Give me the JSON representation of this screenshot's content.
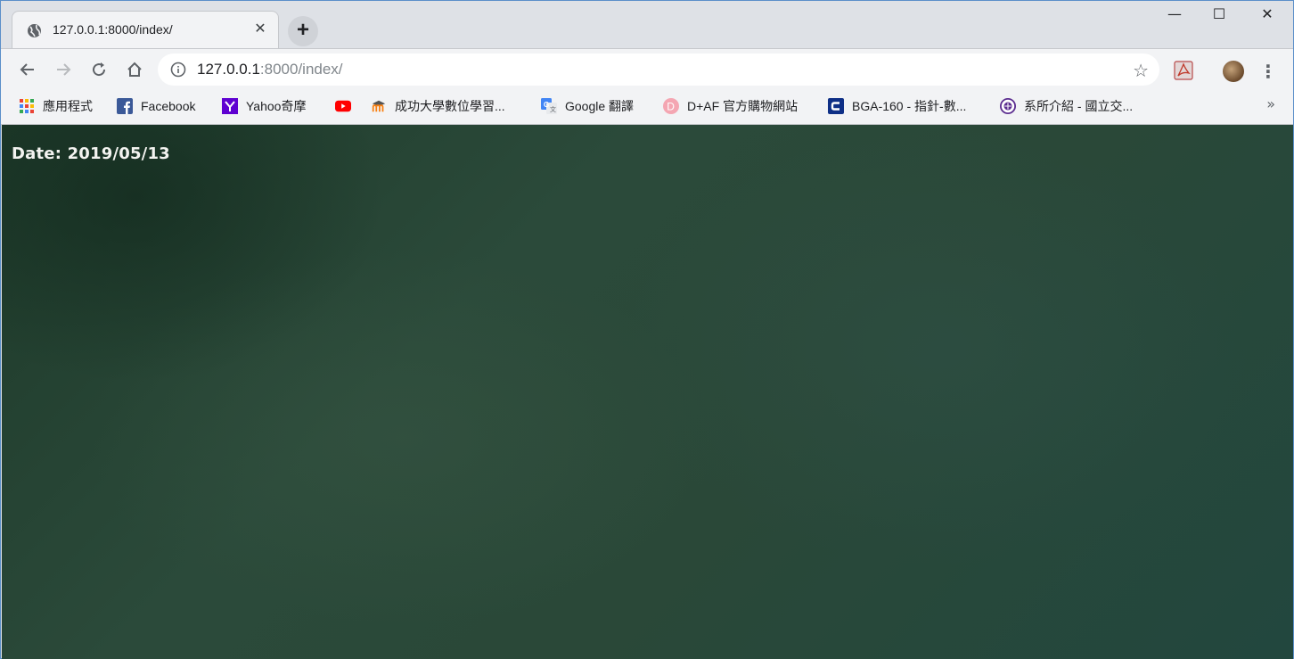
{
  "tab": {
    "title": "127.0.0.1:8000/index/",
    "close_glyph": "✕"
  },
  "newtab_glyph": "+",
  "window": {
    "min_glyph": "—",
    "max_glyph": "☐",
    "close_glyph": "✕"
  },
  "omnibox": {
    "url_host": "127.0.0.1",
    "url_path": ":8000/index/",
    "star_glyph": "☆"
  },
  "menu_glyph": "⋮",
  "bookmarks": [
    {
      "label": "應用程式",
      "icon": "apps-grid-icon"
    },
    {
      "label": "Facebook",
      "icon": "facebook-icon"
    },
    {
      "label": "Yahoo奇摩",
      "icon": "yahoo-icon"
    },
    {
      "label": "",
      "icon": "youtube-icon"
    },
    {
      "label": "成功大學數位學習...",
      "icon": "moodle-icon"
    },
    {
      "label": "Google 翻譯",
      "icon": "google-translate-icon"
    },
    {
      "label": "D+AF 官方購物網站",
      "icon": "daf-icon"
    },
    {
      "label": "BGA-160 - 指針-數...",
      "icon": "casio-icon"
    },
    {
      "label": "系所介紹 - 國立交...",
      "icon": "nctu-icon"
    }
  ],
  "more_glyph": "»",
  "page": {
    "date_text": "Date: 2019/05/13"
  },
  "colors": {
    "chalkboard": "#2a4838",
    "chrome_bg": "#dee1e6",
    "toolbar_bg": "#f2f3f5"
  }
}
